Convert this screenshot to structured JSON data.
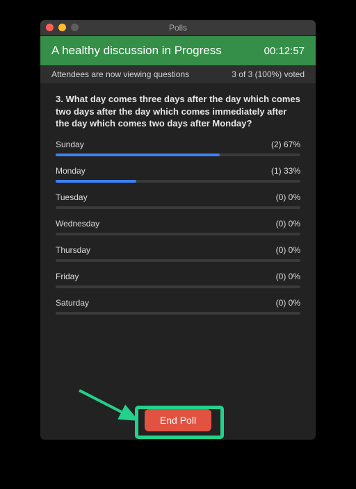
{
  "window": {
    "title": "Polls"
  },
  "header": {
    "title": "A healthy discussion in Progress",
    "timer": "00:12:57"
  },
  "status": {
    "left": "Attendees are now viewing questions",
    "right": "3 of 3 (100%) voted"
  },
  "question": {
    "text": "3. What day comes three days after the day which comes two days after the day which comes immediately after the day which comes two days after Monday?"
  },
  "options": [
    {
      "label": "Sunday",
      "count": 2,
      "percent": 67,
      "display": "(2) 67%"
    },
    {
      "label": "Monday",
      "count": 1,
      "percent": 33,
      "display": "(1) 33%"
    },
    {
      "label": "Tuesday",
      "count": 0,
      "percent": 0,
      "display": "(0) 0%"
    },
    {
      "label": "Wednesday",
      "count": 0,
      "percent": 0,
      "display": "(0) 0%"
    },
    {
      "label": "Thursday",
      "count": 0,
      "percent": 0,
      "display": "(0) 0%"
    },
    {
      "label": "Friday",
      "count": 0,
      "percent": 0,
      "display": "(0) 0%"
    },
    {
      "label": "Saturday",
      "count": 0,
      "percent": 0,
      "display": "(0) 0%"
    }
  ],
  "footer": {
    "end_poll_label": "End Poll"
  },
  "colors": {
    "accent": "#23d18b",
    "bar": "#3b82f6",
    "danger": "#e15241",
    "header_bg": "#358f48"
  }
}
